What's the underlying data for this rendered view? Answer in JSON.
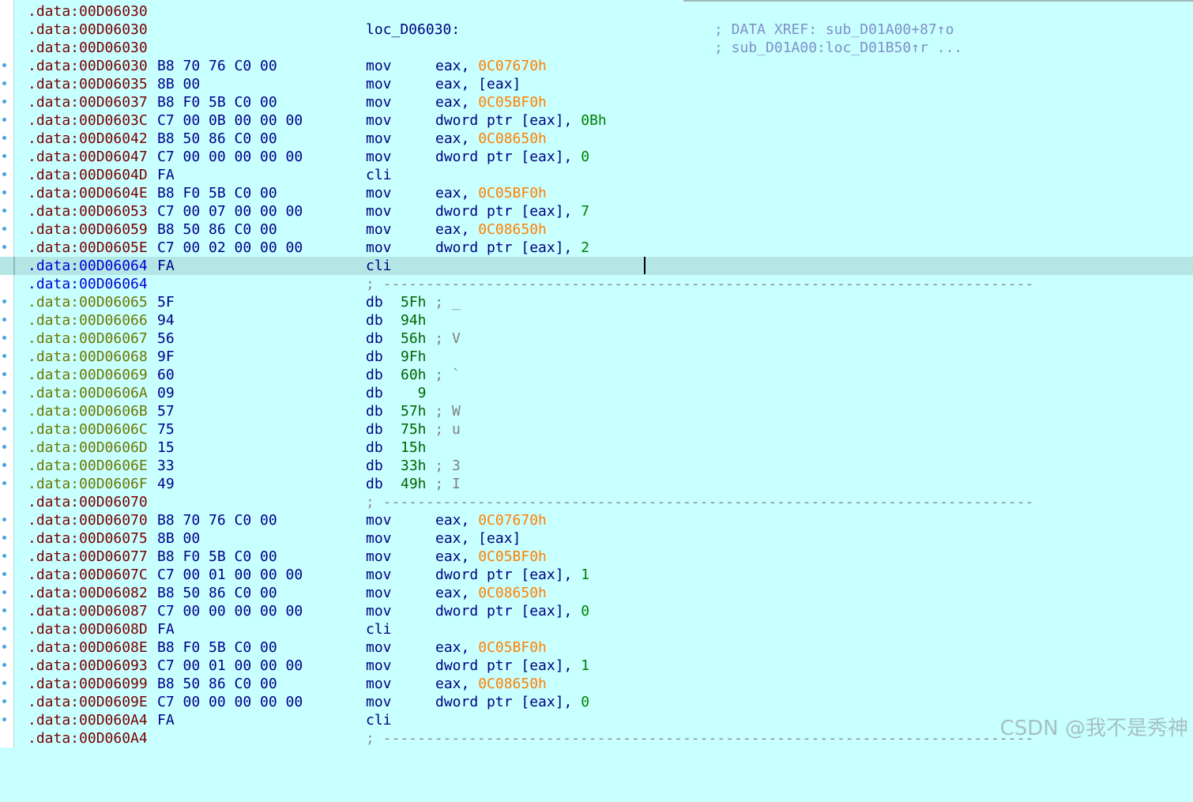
{
  "listing": {
    "xref_label": "loc_D06030:",
    "xref_comment_1": "; DATA XREF: sub_D01A00+87↑o",
    "xref_comment_2": "; sub_D01A00:loc_D01B50↑r ...",
    "separator": "; ----------------------------------------------------------------------------",
    "rows": [
      {
        "addr": ".data:00D06030",
        "bytes": "",
        "mn": "",
        "op": ""
      },
      {
        "addr": ".data:00D06030",
        "bytes": "",
        "mn": "",
        "op": ""
      },
      {
        "addr": ".data:00D06030",
        "bytes": "",
        "mn": "",
        "op": ""
      },
      {
        "addr": ".data:00D06030",
        "bytes": "B8 70 76 C0 00",
        "mn": "mov",
        "op_a": "eax, ",
        "op_b": "0C07670h",
        "op_c": ""
      },
      {
        "addr": ".data:00D06035",
        "bytes": "8B 00",
        "mn": "mov",
        "op_a": "eax, [eax]",
        "op_b": "",
        "op_c": ""
      },
      {
        "addr": ".data:00D06037",
        "bytes": "B8 F0 5B C0 00",
        "mn": "mov",
        "op_a": "eax, ",
        "op_b": "0C05BF0h",
        "op_c": ""
      },
      {
        "addr": ".data:00D0603C",
        "bytes": "C7 00 0B 00 00 00",
        "mn": "mov",
        "op_a": "dword ptr [eax], ",
        "op_b": "",
        "op_c": "0Bh"
      },
      {
        "addr": ".data:00D06042",
        "bytes": "B8 50 86 C0 00",
        "mn": "mov",
        "op_a": "eax, ",
        "op_b": "0C08650h",
        "op_c": ""
      },
      {
        "addr": ".data:00D06047",
        "bytes": "C7 00 00 00 00 00",
        "mn": "mov",
        "op_a": "dword ptr [eax], ",
        "op_b": "",
        "op_c": "0"
      },
      {
        "addr": ".data:00D0604D",
        "bytes": "FA",
        "mn": "cli",
        "op_a": "",
        "op_b": "",
        "op_c": ""
      },
      {
        "addr": ".data:00D0604E",
        "bytes": "B8 F0 5B C0 00",
        "mn": "mov",
        "op_a": "eax, ",
        "op_b": "0C05BF0h",
        "op_c": ""
      },
      {
        "addr": ".data:00D06053",
        "bytes": "C7 00 07 00 00 00",
        "mn": "mov",
        "op_a": "dword ptr [eax], ",
        "op_b": "",
        "op_c": "7"
      },
      {
        "addr": ".data:00D06059",
        "bytes": "B8 50 86 C0 00",
        "mn": "mov",
        "op_a": "eax, ",
        "op_b": "0C08650h",
        "op_c": ""
      },
      {
        "addr": ".data:00D0605E",
        "bytes": "C7 00 02 00 00 00",
        "mn": "mov",
        "op_a": "dword ptr [eax], ",
        "op_b": "",
        "op_c": "2"
      },
      {
        "addr": ".data:00D06064",
        "bytes": "FA",
        "mn": "cli",
        "op_a": "",
        "op_b": "",
        "op_c": ""
      },
      {
        "addr": ".data:00D06064",
        "bytes": "",
        "mn": "",
        "op_a": "",
        "op_b": "",
        "op_c": ""
      },
      {
        "addr": ".data:00D06065",
        "bytes": "5F",
        "mn": "db",
        "db": "5Fh",
        "dc": "; _"
      },
      {
        "addr": ".data:00D06066",
        "bytes": "94",
        "mn": "db",
        "db": "94h",
        "dc": ""
      },
      {
        "addr": ".data:00D06067",
        "bytes": "56",
        "mn": "db",
        "db": "56h",
        "dc": "; V"
      },
      {
        "addr": ".data:00D06068",
        "bytes": "9F",
        "mn": "db",
        "db": "9Fh",
        "dc": ""
      },
      {
        "addr": ".data:00D06069",
        "bytes": "60",
        "mn": "db",
        "db": "60h",
        "dc": "; `"
      },
      {
        "addr": ".data:00D0606A",
        "bytes": "09",
        "mn": "db",
        "db": "  9",
        "dc": ""
      },
      {
        "addr": ".data:00D0606B",
        "bytes": "57",
        "mn": "db",
        "db": "57h",
        "dc": "; W"
      },
      {
        "addr": ".data:00D0606C",
        "bytes": "75",
        "mn": "db",
        "db": "75h",
        "dc": "; u"
      },
      {
        "addr": ".data:00D0606D",
        "bytes": "15",
        "mn": "db",
        "db": "15h",
        "dc": ""
      },
      {
        "addr": ".data:00D0606E",
        "bytes": "33",
        "mn": "db",
        "db": "33h",
        "dc": "; 3"
      },
      {
        "addr": ".data:00D0606F",
        "bytes": "49",
        "mn": "db",
        "db": "49h",
        "dc": "; I"
      },
      {
        "addr": ".data:00D06070",
        "bytes": "",
        "mn": "",
        "op_a": "",
        "op_b": "",
        "op_c": ""
      },
      {
        "addr": ".data:00D06070",
        "bytes": "B8 70 76 C0 00",
        "mn": "mov",
        "op_a": "eax, ",
        "op_b": "0C07670h",
        "op_c": ""
      },
      {
        "addr": ".data:00D06075",
        "bytes": "8B 00",
        "mn": "mov",
        "op_a": "eax, [eax]",
        "op_b": "",
        "op_c": ""
      },
      {
        "addr": ".data:00D06077",
        "bytes": "B8 F0 5B C0 00",
        "mn": "mov",
        "op_a": "eax, ",
        "op_b": "0C05BF0h",
        "op_c": ""
      },
      {
        "addr": ".data:00D0607C",
        "bytes": "C7 00 01 00 00 00",
        "mn": "mov",
        "op_a": "dword ptr [eax], ",
        "op_b": "",
        "op_c": "1"
      },
      {
        "addr": ".data:00D06082",
        "bytes": "B8 50 86 C0 00",
        "mn": "mov",
        "op_a": "eax, ",
        "op_b": "0C08650h",
        "op_c": ""
      },
      {
        "addr": ".data:00D06087",
        "bytes": "C7 00 00 00 00 00",
        "mn": "mov",
        "op_a": "dword ptr [eax], ",
        "op_b": "",
        "op_c": "0"
      },
      {
        "addr": ".data:00D0608D",
        "bytes": "FA",
        "mn": "cli",
        "op_a": "",
        "op_b": "",
        "op_c": ""
      },
      {
        "addr": ".data:00D0608E",
        "bytes": "B8 F0 5B C0 00",
        "mn": "mov",
        "op_a": "eax, ",
        "op_b": "0C05BF0h",
        "op_c": ""
      },
      {
        "addr": ".data:00D06093",
        "bytes": "C7 00 01 00 00 00",
        "mn": "mov",
        "op_a": "dword ptr [eax], ",
        "op_b": "",
        "op_c": "1"
      },
      {
        "addr": ".data:00D06099",
        "bytes": "B8 50 86 C0 00",
        "mn": "mov",
        "op_a": "eax, ",
        "op_b": "0C08650h",
        "op_c": ""
      },
      {
        "addr": ".data:00D0609E",
        "bytes": "C7 00 00 00 00 00",
        "mn": "mov",
        "op_a": "dword ptr [eax], ",
        "op_b": "",
        "op_c": "0"
      },
      {
        "addr": ".data:00D060A4",
        "bytes": "FA",
        "mn": "cli",
        "op_a": "",
        "op_b": "",
        "op_c": ""
      },
      {
        "addr": ".data:00D060A4",
        "bytes": "",
        "mn": "",
        "op_a": "",
        "op_b": "",
        "op_c": ""
      }
    ]
  },
  "colors": {
    "background": "#c8ffff",
    "hex_immediate": "#ff8000",
    "numeric": "#008000",
    "code_address": "#7a0000",
    "data_address": "#6e7700",
    "current_address": "#0000d8",
    "comment": "#8090c8"
  },
  "watermark": "CSDN @我不是秀神"
}
